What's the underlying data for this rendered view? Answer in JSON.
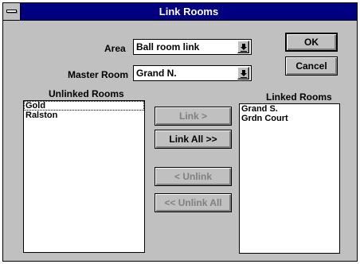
{
  "window": {
    "title": "Link Rooms"
  },
  "area": {
    "label": "Area",
    "value": "Ball room link"
  },
  "master_room": {
    "label": "Master Room",
    "value": "Grand N."
  },
  "buttons": {
    "ok": "OK",
    "cancel": "Cancel",
    "link": "Link >",
    "link_all": "Link All >>",
    "unlink": "< Unlink",
    "unlink_all": "<< Unlink All"
  },
  "unlinked": {
    "label": "Unlinked Rooms",
    "items": [
      "Gold",
      "Ralston"
    ]
  },
  "linked": {
    "label": "Linked Rooms",
    "items": [
      "Grand S.",
      "Grdn Court"
    ]
  },
  "icons": {
    "system_menu": "system-menu-icon",
    "dropdown": "chevron-down-icon"
  },
  "colors": {
    "titlebar": "#000080",
    "face": "#c0c0c0",
    "disabled_text": "#808080"
  }
}
